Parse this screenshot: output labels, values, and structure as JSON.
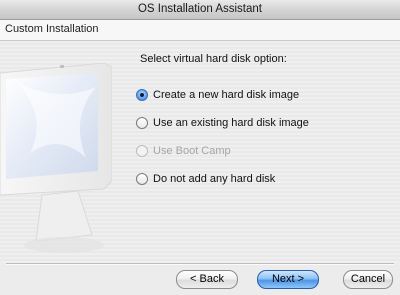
{
  "window": {
    "title": "OS Installation Assistant"
  },
  "header": {
    "title": "Custom Installation"
  },
  "main": {
    "prompt": "Select virtual hard disk option:",
    "options": [
      {
        "label": "Create a new hard disk image",
        "selected": true,
        "enabled": true
      },
      {
        "label": "Use an existing hard disk image",
        "selected": false,
        "enabled": true
      },
      {
        "label": "Use Boot Camp",
        "selected": false,
        "enabled": false
      },
      {
        "label": "Do not add any hard disk",
        "selected": false,
        "enabled": true
      }
    ]
  },
  "footer": {
    "back_label": "< Back",
    "next_label": "Next >",
    "cancel_label": "Cancel"
  },
  "colors": {
    "accent": "#4f95e4",
    "disabled_text": "#a5a5a5"
  },
  "icons": {
    "illustration": "computer-monitor-illustration"
  }
}
